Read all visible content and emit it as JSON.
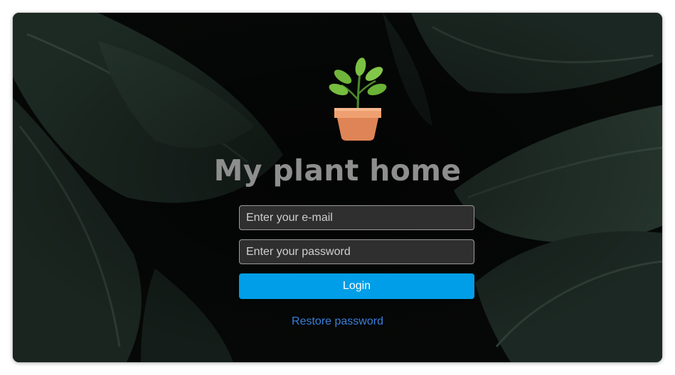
{
  "app": {
    "title": "My plant home",
    "logo_icon": "potted-plant-icon"
  },
  "form": {
    "email_placeholder": "Enter your e-mail",
    "email_value": "",
    "password_placeholder": "Enter your password",
    "password_value": "",
    "login_label": "Login",
    "restore_label": "Restore password"
  },
  "colors": {
    "accent": "#009ee8",
    "link": "#3a7fd8",
    "title": "#8e8e8e",
    "field_bg": "#2f2f2f",
    "background": "#070807"
  }
}
